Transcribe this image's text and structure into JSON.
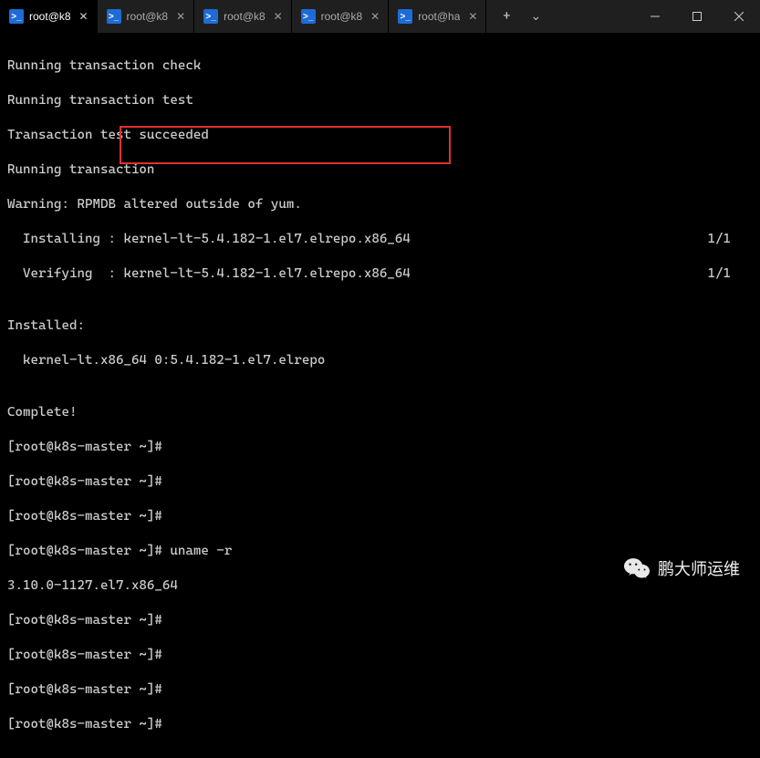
{
  "tabs": [
    {
      "label": "root@k8",
      "active": true
    },
    {
      "label": "root@k8",
      "active": false
    },
    {
      "label": "root@k8",
      "active": false
    },
    {
      "label": "root@k8",
      "active": false
    },
    {
      "label": "root@ha",
      "active": false
    }
  ],
  "new_tab_label": "+",
  "dropdown_label": "⌄",
  "terminal": {
    "l0": "Running transaction check",
    "l1": "Running transaction test",
    "l2": "Transaction test succeeded",
    "l3": "Running transaction",
    "l4": "Warning: RPMDB altered outside of yum.",
    "l5_left": "  Installing : kernel-lt-5.4.182-1.el7.elrepo.x86_64",
    "l5_right": "1/1",
    "l6_left": "  Verifying  : kernel-lt-5.4.182-1.el7.elrepo.x86_64",
    "l6_right": "1/1",
    "l7": "",
    "l8": "Installed:",
    "l9": "  kernel-lt.x86_64 0:5.4.182-1.el7.elrepo",
    "l10": "",
    "l11": "Complete!",
    "l12": "[root@k8s-master ~]#",
    "l13": "[root@k8s-master ~]#",
    "l14": "[root@k8s-master ~]#",
    "l15": "[root@k8s-master ~]# uname -r",
    "l16": "3.10.0-1127.el7.x86_64",
    "l17": "[root@k8s-master ~]#",
    "l18": "[root@k8s-master ~]#",
    "l19": "[root@k8s-master ~]#",
    "l20": "[root@k8s-master ~]#"
  },
  "watermark_text": "鹏大师运维",
  "ps_glyph": ">_"
}
